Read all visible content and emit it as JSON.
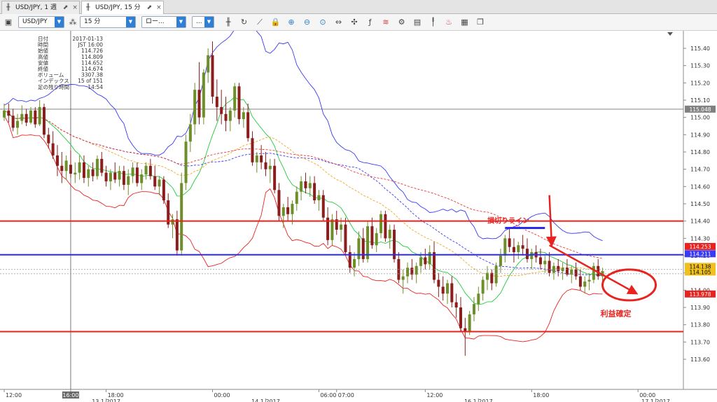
{
  "tabs": [
    {
      "label": "USD/JPY, 1 週",
      "active": false
    },
    {
      "label": "USD/JPY, 15 分",
      "active": true
    }
  ],
  "toolbar": {
    "symbol": "USD/JPY",
    "period": "15 分",
    "chart_style": "ロー...",
    "more": "...",
    "icons": [
      "candle-icon",
      "refresh-icon",
      "trendline-icon",
      "lock-icon",
      "zoom-in-icon",
      "zoom-out-icon",
      "zoom-reset-icon",
      "fit-icon",
      "crosshair-icon",
      "indicator-icon",
      "oscillator-icon",
      "settings-icon",
      "save-icon",
      "signal-icon",
      "alert-icon",
      "calendar-icon",
      "copy-icon"
    ]
  },
  "info_panel": [
    {
      "label": "日付",
      "value": "2017-01-13"
    },
    {
      "label": "時間",
      "value": "JST 16:00"
    },
    {
      "label": "始値",
      "value": "114.726"
    },
    {
      "label": "高値",
      "value": "114.809"
    },
    {
      "label": "安値",
      "value": "114.652"
    },
    {
      "label": "終値",
      "value": "114.674"
    },
    {
      "label": "ボリューム",
      "value": "3307.38"
    },
    {
      "label": "インデックス",
      "value": "15 of 151"
    },
    {
      "label": "足の残り時間",
      "value": "14:54"
    }
  ],
  "annotations": {
    "stop_loss": "損切りライン",
    "take_profit": "利益確定"
  },
  "chart_data": {
    "type": "candlestick",
    "ylim": [
      113.6,
      115.55
    ],
    "y_ticks": [
      "115.40",
      "115.30",
      "115.20",
      "115.10",
      "115.00",
      "114.90",
      "114.80",
      "114.70",
      "114.60",
      "114.50",
      "114.40",
      "114.30",
      "114.20",
      "114.10",
      "114.00",
      "113.90",
      "113.80",
      "113.70",
      "113.60"
    ],
    "x_ticks": [
      {
        "label": "12:00",
        "x": 0
      },
      {
        "label": "16:00",
        "x": 15,
        "highlight": true
      },
      {
        "label": "18:00",
        "x": 23
      },
      {
        "label": "00:00",
        "x": 47
      },
      {
        "label": "06:00",
        "x": 71
      },
      {
        "label": "07:00",
        "x": 75
      },
      {
        "label": "12:00",
        "x": 95
      },
      {
        "label": "18:00",
        "x": 119
      },
      {
        "label": "00:00",
        "x": 143
      }
    ],
    "date_labels": [
      {
        "label": "13 1 2017",
        "x": 23
      },
      {
        "label": "14 1 2017",
        "x": 59
      },
      {
        "label": "16 1 2017",
        "x": 107
      },
      {
        "label": "17 1 2017",
        "x": 147
      }
    ],
    "price_labels": [
      {
        "value": "115.048",
        "color": "#808080"
      },
      {
        "value": "114.253",
        "color": "#e8231f"
      },
      {
        "value": "114.211",
        "color": "#3a3af5"
      },
      {
        "value": "114.138",
        "color": "#f0c020"
      },
      {
        "value": "114.105",
        "color": "#f0c020"
      },
      {
        "value": "113.978",
        "color": "#e8231f"
      }
    ],
    "levels": {
      "red_top": 114.4,
      "blue": 114.205,
      "red_bottom": 113.76,
      "gray_high": 115.048
    },
    "candles": [
      [
        115.0,
        115.08,
        114.98,
        115.04
      ],
      [
        115.04,
        115.08,
        114.97,
        115.01
      ],
      [
        115.01,
        115.05,
        114.92,
        114.94
      ],
      [
        114.94,
        115.02,
        114.9,
        114.98
      ],
      [
        114.98,
        115.07,
        114.96,
        115.02
      ],
      [
        115.02,
        115.05,
        114.95,
        114.97
      ],
      [
        114.97,
        115.06,
        114.96,
        115.04
      ],
      [
        115.04,
        115.06,
        114.94,
        114.96
      ],
      [
        114.96,
        115.1,
        114.95,
        115.06
      ],
      [
        115.06,
        115.08,
        114.88,
        114.9
      ],
      [
        114.9,
        114.94,
        114.82,
        114.85
      ],
      [
        114.85,
        114.92,
        114.76,
        114.78
      ],
      [
        114.78,
        114.84,
        114.66,
        114.72
      ],
      [
        114.72,
        114.8,
        114.62,
        114.69
      ],
      [
        114.69,
        114.78,
        114.64,
        114.75
      ],
      [
        114.726,
        114.809,
        114.652,
        114.674
      ],
      [
        114.67,
        114.74,
        114.62,
        114.68
      ],
      [
        114.68,
        114.78,
        114.64,
        114.74
      ],
      [
        114.74,
        114.78,
        114.62,
        114.65
      ],
      [
        114.65,
        114.72,
        114.6,
        114.7
      ],
      [
        114.7,
        114.74,
        114.63,
        114.66
      ],
      [
        114.66,
        114.78,
        114.64,
        114.76
      ],
      [
        114.76,
        114.8,
        114.66,
        114.68
      ],
      [
        114.68,
        114.72,
        114.6,
        114.63
      ],
      [
        114.63,
        114.7,
        114.58,
        114.68
      ],
      [
        114.68,
        114.74,
        114.62,
        114.64
      ],
      [
        114.64,
        114.72,
        114.6,
        114.69
      ],
      [
        114.69,
        114.72,
        114.58,
        114.61
      ],
      [
        114.61,
        114.7,
        114.55,
        114.66
      ],
      [
        114.66,
        114.74,
        114.62,
        114.71
      ],
      [
        114.71,
        114.74,
        114.6,
        114.62
      ],
      [
        114.62,
        114.7,
        114.58,
        114.67
      ],
      [
        114.67,
        114.74,
        114.64,
        114.72
      ],
      [
        114.72,
        114.76,
        114.64,
        114.66
      ],
      [
        114.66,
        114.72,
        114.58,
        114.6
      ],
      [
        114.6,
        114.66,
        114.55,
        114.64
      ],
      [
        114.64,
        114.66,
        114.5,
        114.52
      ],
      [
        114.52,
        114.56,
        114.36,
        114.38
      ],
      [
        114.38,
        114.44,
        114.3,
        114.41
      ],
      [
        114.41,
        114.46,
        114.2,
        114.23
      ],
      [
        114.23,
        114.68,
        114.2,
        114.62
      ],
      [
        114.62,
        114.9,
        114.58,
        114.86
      ],
      [
        114.86,
        115.02,
        114.8,
        114.96
      ],
      [
        114.96,
        115.2,
        114.9,
        115.16
      ],
      [
        115.16,
        115.32,
        114.96,
        115.0
      ],
      [
        115.0,
        115.28,
        114.96,
        115.26
      ],
      [
        115.26,
        115.4,
        115.2,
        115.36
      ],
      [
        115.36,
        115.44,
        115.08,
        115.12
      ],
      [
        115.12,
        115.22,
        114.98,
        115.06
      ],
      [
        115.06,
        115.16,
        114.96,
        115.02
      ],
      [
        115.02,
        115.12,
        114.92,
        114.98
      ],
      [
        114.98,
        115.06,
        114.92,
        115.04
      ],
      [
        115.04,
        115.2,
        115.0,
        115.18
      ],
      [
        115.18,
        115.2,
        114.96,
        114.99
      ],
      [
        114.99,
        115.06,
        114.94,
        115.03
      ],
      [
        115.03,
        115.08,
        114.86,
        114.88
      ],
      [
        114.88,
        114.92,
        114.72,
        114.74
      ],
      [
        114.74,
        114.8,
        114.68,
        114.78
      ],
      [
        114.78,
        114.84,
        114.7,
        114.74
      ],
      [
        114.74,
        114.8,
        114.66,
        114.7
      ],
      [
        114.7,
        114.76,
        114.62,
        114.72
      ],
      [
        114.72,
        114.76,
        114.56,
        114.58
      ],
      [
        114.58,
        114.62,
        114.4,
        114.43
      ],
      [
        114.43,
        114.5,
        114.36,
        114.48
      ],
      [
        114.48,
        114.54,
        114.4,
        114.44
      ],
      [
        114.44,
        114.52,
        114.38,
        114.5
      ],
      [
        114.5,
        114.6,
        114.46,
        114.57
      ],
      [
        114.57,
        114.66,
        114.52,
        114.63
      ],
      [
        114.63,
        114.68,
        114.56,
        114.59
      ],
      [
        114.59,
        114.66,
        114.54,
        114.62
      ],
      [
        114.62,
        114.66,
        114.5,
        114.52
      ],
      [
        114.52,
        114.58,
        114.46,
        114.55
      ],
      [
        114.55,
        114.58,
        114.4,
        114.42
      ],
      [
        114.42,
        114.48,
        114.26,
        114.29
      ],
      [
        114.29,
        114.44,
        114.26,
        114.41
      ],
      [
        114.41,
        114.46,
        114.32,
        114.35
      ],
      [
        114.35,
        114.42,
        114.28,
        114.38
      ],
      [
        114.38,
        114.42,
        114.2,
        114.22
      ],
      [
        114.22,
        114.26,
        114.1,
        114.13
      ],
      [
        114.13,
        114.22,
        114.08,
        114.18
      ],
      [
        114.18,
        114.34,
        114.14,
        114.3
      ],
      [
        114.3,
        114.36,
        114.16,
        114.18
      ],
      [
        114.18,
        114.4,
        114.16,
        114.37
      ],
      [
        114.37,
        114.42,
        114.24,
        114.26
      ],
      [
        114.26,
        114.36,
        114.22,
        114.33
      ],
      [
        114.33,
        114.46,
        114.3,
        114.44
      ],
      [
        114.44,
        114.46,
        114.28,
        114.3
      ],
      [
        114.3,
        114.38,
        114.24,
        114.35
      ],
      [
        114.35,
        114.38,
        114.16,
        114.18
      ],
      [
        114.18,
        114.22,
        114.04,
        114.06
      ],
      [
        114.06,
        114.12,
        113.98,
        114.08
      ],
      [
        114.08,
        114.16,
        114.04,
        114.13
      ],
      [
        114.13,
        114.18,
        114.06,
        114.09
      ],
      [
        114.09,
        114.16,
        114.04,
        114.14
      ],
      [
        114.14,
        114.22,
        114.1,
        114.19
      ],
      [
        114.19,
        114.24,
        114.12,
        114.15
      ],
      [
        114.15,
        114.26,
        114.12,
        114.22
      ],
      [
        114.22,
        114.28,
        114.04,
        114.06
      ],
      [
        114.06,
        114.1,
        113.96,
        114.02
      ],
      [
        114.02,
        114.08,
        113.94,
        113.98
      ],
      [
        113.98,
        114.06,
        113.92,
        114.04
      ],
      [
        114.04,
        114.08,
        113.9,
        113.93
      ],
      [
        113.93,
        113.98,
        113.84,
        113.9
      ],
      [
        113.9,
        113.96,
        113.76,
        113.78
      ],
      [
        113.78,
        113.84,
        113.62,
        113.76
      ],
      [
        113.76,
        113.88,
        113.74,
        113.86
      ],
      [
        113.86,
        113.96,
        113.82,
        113.92
      ],
      [
        113.92,
        114.02,
        113.88,
        113.98
      ],
      [
        113.98,
        114.08,
        113.94,
        114.06
      ],
      [
        114.06,
        114.14,
        114.0,
        114.1
      ],
      [
        114.1,
        114.12,
        114.0,
        114.04
      ],
      [
        114.04,
        114.16,
        114.02,
        114.14
      ],
      [
        114.14,
        114.24,
        114.1,
        114.2
      ],
      [
        114.2,
        114.32,
        114.16,
        114.3
      ],
      [
        114.3,
        114.36,
        114.22,
        114.25
      ],
      [
        114.25,
        114.3,
        114.16,
        114.22
      ],
      [
        114.22,
        114.28,
        114.18,
        114.26
      ],
      [
        114.26,
        114.32,
        114.2,
        114.24
      ],
      [
        114.24,
        114.3,
        114.16,
        114.18
      ],
      [
        114.18,
        114.24,
        114.12,
        114.22
      ],
      [
        114.22,
        114.26,
        114.16,
        114.19
      ],
      [
        114.19,
        114.24,
        114.12,
        114.15
      ],
      [
        114.15,
        114.2,
        114.1,
        114.17
      ],
      [
        114.17,
        114.22,
        114.08,
        114.1
      ],
      [
        114.1,
        114.16,
        114.06,
        114.14
      ],
      [
        114.14,
        114.18,
        114.08,
        114.11
      ],
      [
        114.11,
        114.16,
        114.06,
        114.13
      ],
      [
        114.13,
        114.18,
        114.08,
        114.09
      ],
      [
        114.09,
        114.14,
        114.04,
        114.12
      ],
      [
        114.12,
        114.16,
        114.06,
        114.08
      ],
      [
        114.08,
        114.12,
        114.0,
        114.02
      ],
      [
        114.02,
        114.08,
        113.98,
        114.05
      ],
      [
        114.05,
        114.1,
        114.0,
        114.06
      ],
      [
        114.06,
        114.16,
        114.04,
        114.14
      ],
      [
        114.14,
        114.18,
        114.06,
        114.08
      ],
      [
        114.08,
        114.13,
        114.04,
        114.11
      ]
    ]
  }
}
